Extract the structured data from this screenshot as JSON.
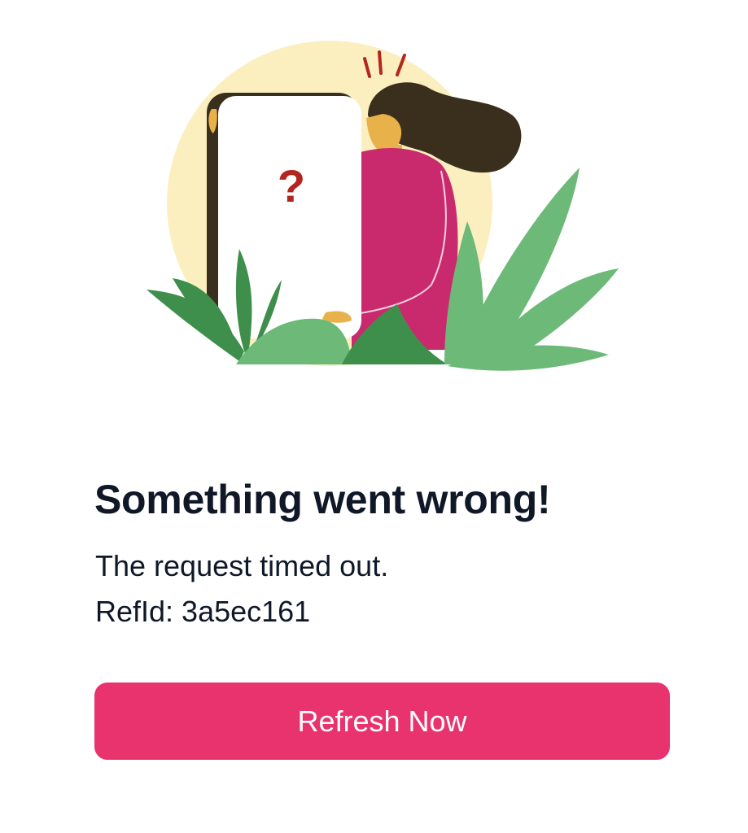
{
  "error": {
    "title": "Something went wrong!",
    "message": "The request timed out.",
    "ref_id": "RefId: 3a5ec161"
  },
  "actions": {
    "refresh_label": "Refresh Now"
  },
  "illustration": {
    "question_mark": "?",
    "description_icon": "woman-holding-phone-illustration"
  },
  "colors": {
    "accent": "#e8336f",
    "title": "#101828",
    "sun": "#fbefc0",
    "shirt": "#c92a6d",
    "hair": "#3a2f1d",
    "skin": "#e8b14a",
    "leaf_light": "#6cb978",
    "leaf_dark": "#3e8f4c",
    "alert": "#b3261e"
  }
}
